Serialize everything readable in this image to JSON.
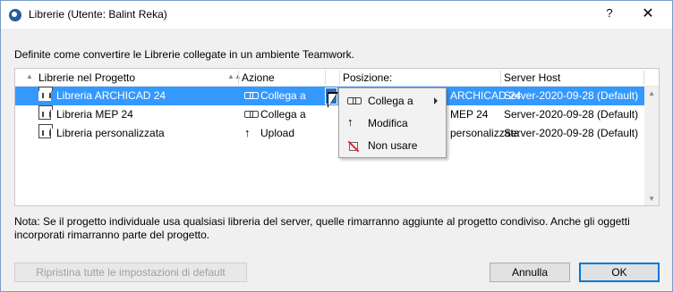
{
  "window": {
    "title": "Librerie (Utente: Balint Reka)",
    "help_label": "?",
    "close_label": "✕"
  },
  "intro_text": "Definite come convertire le Librerie collegate in un ambiente Teamwork.",
  "table": {
    "headers": {
      "library": "Librerie nel Progetto",
      "action": "Azione",
      "position": "Posizione:",
      "server": "Server Host"
    },
    "rows": [
      {
        "name": "Libreria ARCHICAD 24",
        "action": "Collega a",
        "action_icon": "link-icon",
        "position": "ARCHICAD 24",
        "server": "Server-2020-09-28 (Default)",
        "selected": true
      },
      {
        "name": "Libreria MEP 24",
        "action": "Collega a",
        "action_icon": "link-icon",
        "position": "MEP 24",
        "server": "Server-2020-09-28 (Default)",
        "selected": false
      },
      {
        "name": "Libreria personalizzata",
        "action": "Upload",
        "action_icon": "upload-arrow-icon",
        "position": "personalizzata",
        "server": "Server-2020-09-28 (Default)",
        "selected": false
      }
    ]
  },
  "popup_menu": {
    "items": [
      {
        "label": "Collega a",
        "icon": "link-icon",
        "has_submenu": true
      },
      {
        "label": "Modifica",
        "icon": "upload-arrow-icon",
        "has_submenu": false
      },
      {
        "label": "Non usare",
        "icon": "no-use-icon",
        "has_submenu": false
      }
    ]
  },
  "note": "Nota: Se il progetto individuale usa qualsiasi libreria del server, quelle rimarranno aggiunte al progetto condiviso. Anche gli oggetti incorporati rimarranno parte del progetto.",
  "buttons": {
    "reset": "Ripristina tutte le impostazioni di default",
    "cancel": "Annulla",
    "ok": "OK"
  },
  "colors": {
    "selection": "#3399ff",
    "accent": "#0078d7"
  }
}
